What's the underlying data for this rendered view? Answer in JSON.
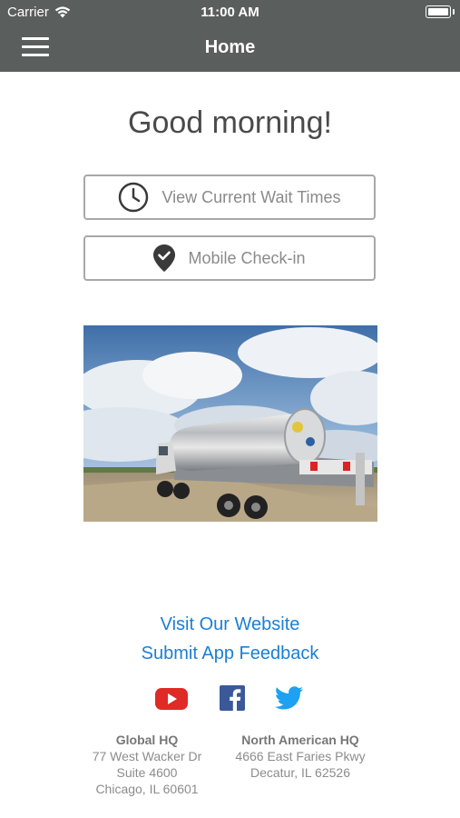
{
  "status_bar": {
    "carrier": "Carrier",
    "time": "11:00 AM",
    "icons": [
      "wifi-icon",
      "battery-icon"
    ]
  },
  "nav": {
    "title": "Home",
    "menu_icon": "hamburger-menu-icon"
  },
  "main": {
    "greeting": "Good morning!",
    "buttons": [
      {
        "label": "View Current Wait Times",
        "icon": "clock-icon"
      },
      {
        "label": "Mobile Check-in",
        "icon": "location-check-icon"
      }
    ],
    "hero_image": "tanker-truck-photo"
  },
  "footer": {
    "links": [
      "Visit Our Website",
      "Submit App Feedback"
    ],
    "social": [
      "youtube-icon",
      "facebook-icon",
      "twitter-icon"
    ],
    "addresses": [
      {
        "title": "Global HQ",
        "lines": [
          "77 West Wacker Dr",
          "Suite 4600",
          "Chicago, IL 60601"
        ]
      },
      {
        "title": "North American HQ",
        "lines": [
          "4666 East Faries Pkwy",
          "Decatur, IL 62526"
        ]
      }
    ]
  },
  "colors": {
    "nav_background": "#5a5e5c",
    "link": "#1a7fd6",
    "youtube": "#e02a26",
    "facebook": "#3b5998",
    "twitter": "#1da1f2"
  }
}
